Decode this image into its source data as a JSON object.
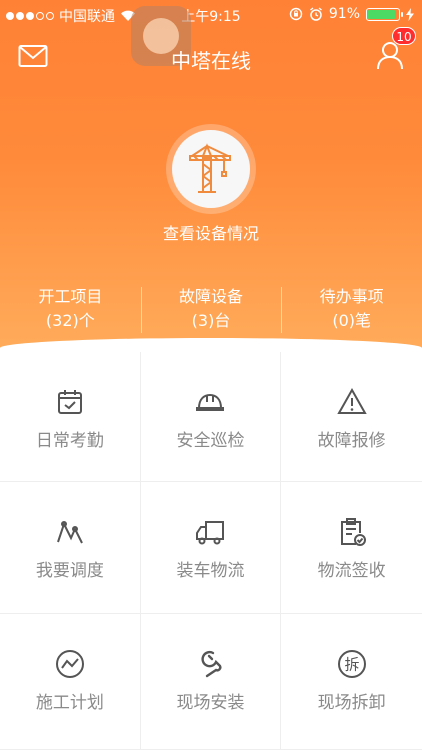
{
  "status_bar": {
    "carrier": "中国联通",
    "time": "上午9:15",
    "battery": "91%",
    "battery_level": 0.91
  },
  "nav": {
    "title": "中塔在线",
    "notification_count": "10",
    "icons": [
      "mail-icon",
      "user-icon"
    ]
  },
  "hero": {
    "equipment_label": "查看设备情况",
    "icon": "tower-crane-icon"
  },
  "stats": [
    {
      "label": "开工项目",
      "value": "(32)个"
    },
    {
      "label": "故障设备",
      "value": "(3)台"
    },
    {
      "label": "待办事项",
      "value": "(0)笔"
    }
  ],
  "menu": [
    {
      "label": "日常考勤",
      "icon": "calendar-check-icon"
    },
    {
      "label": "安全巡检",
      "icon": "hard-hat-icon"
    },
    {
      "label": "故障报修",
      "icon": "warning-icon"
    },
    {
      "label": "我要调度",
      "icon": "route-icon"
    },
    {
      "label": "装车物流",
      "icon": "truck-icon"
    },
    {
      "label": "物流签收",
      "icon": "clipboard-check-icon"
    },
    {
      "label": "施工计划",
      "icon": "trend-icon"
    },
    {
      "label": "现场安装",
      "icon": "wrench-icon"
    },
    {
      "label": "现场拆卸",
      "icon": "dismantle-icon"
    }
  ],
  "colors": {
    "header_top": "#ff8136",
    "header_bottom": "#ffab5a",
    "crane_orange": "#f08a3c",
    "menu_icon": "#555555",
    "menu_text": "#8a8a8a",
    "badge": "#ff2d2d"
  }
}
